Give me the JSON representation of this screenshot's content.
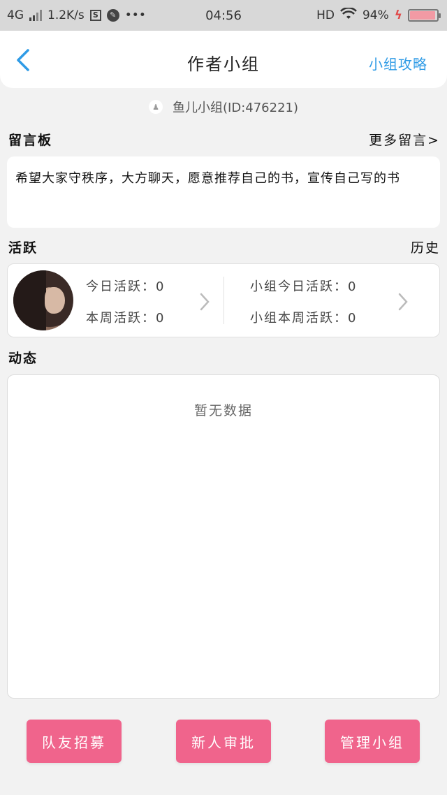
{
  "status_bar": {
    "network": "4G",
    "speed": "1.2K/s",
    "app_icon_1": "S",
    "more": "•••",
    "time": "04:56",
    "hd": "HD",
    "battery_percent": "94%",
    "battery_level": 0.94
  },
  "nav": {
    "title": "作者小组",
    "action": "小组攻略"
  },
  "group": {
    "name_id": "鱼儿小组(ID:476221)"
  },
  "message_board": {
    "label": "留言板",
    "more": "更多留言>",
    "content": "希望大家守秩序，大方聊天，愿意推荐自己的书，宣传自己写的书"
  },
  "activity": {
    "label": "活跃",
    "history": "历史",
    "today": "今日活跃：0",
    "week": "本周活跃：0",
    "group_today": "小组今日活跃：0",
    "group_week": "小组本周活跃：0"
  },
  "feed": {
    "label": "动态",
    "empty": "暂无数据"
  },
  "buttons": {
    "recruit": "队友招募",
    "approve": "新人审批",
    "manage": "管理小组"
  },
  "colors": {
    "accent_blue": "#2f9be6",
    "button_pink": "#f0648c"
  },
  "icons": {
    "back": "chevron-left-icon",
    "chevron": "chevron-right-icon"
  }
}
